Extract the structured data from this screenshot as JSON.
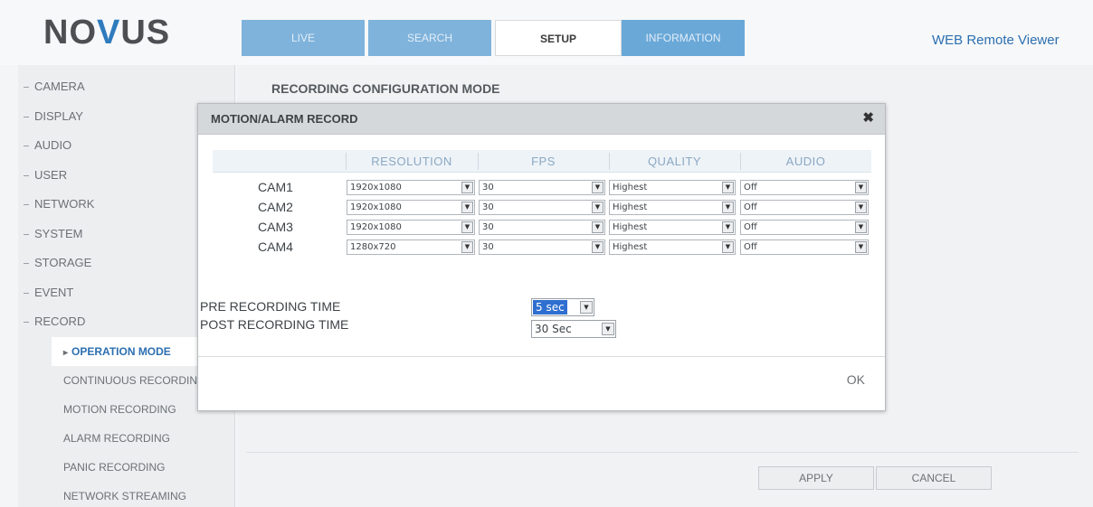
{
  "header": {
    "logo_prefix": "NO",
    "logo_v": "V",
    "logo_suffix": "US",
    "tabs": [
      {
        "label": "LIVE"
      },
      {
        "label": "SEARCH"
      },
      {
        "label": "SETUP"
      },
      {
        "label": "INFORMATION"
      }
    ],
    "active_tab": "SETUP",
    "app_title": "WEB Remote Viewer"
  },
  "sidebar": {
    "items": [
      {
        "label": "CAMERA"
      },
      {
        "label": "DISPLAY"
      },
      {
        "label": "AUDIO"
      },
      {
        "label": "USER"
      },
      {
        "label": "NETWORK"
      },
      {
        "label": "SYSTEM"
      },
      {
        "label": "STORAGE"
      },
      {
        "label": "EVENT"
      },
      {
        "label": "RECORD"
      }
    ],
    "sub_items": [
      {
        "label": "OPERATION MODE"
      },
      {
        "label": "CONTINUOUS RECORDING"
      },
      {
        "label": "MOTION RECORDING"
      },
      {
        "label": "ALARM RECORDING"
      },
      {
        "label": "PANIC RECORDING"
      },
      {
        "label": "NETWORK STREAMING"
      }
    ]
  },
  "main": {
    "section_title": "RECORDING CONFIGURATION MODE",
    "apply_label": "APPLY",
    "cancel_label": "CANCEL"
  },
  "modal": {
    "title": "MOTION/ALARM RECORD",
    "close_glyph": "✖",
    "columns": [
      "RESOLUTION",
      "FPS",
      "QUALITY",
      "AUDIO"
    ],
    "cameras": [
      {
        "name": "CAM1",
        "resolution": "1920x1080",
        "fps": "30",
        "quality": "Highest",
        "audio": "Off"
      },
      {
        "name": "CAM2",
        "resolution": "1920x1080",
        "fps": "30",
        "quality": "Highest",
        "audio": "Off"
      },
      {
        "name": "CAM3",
        "resolution": "1920x1080",
        "fps": "30",
        "quality": "Highest",
        "audio": "Off"
      },
      {
        "name": "CAM4",
        "resolution": "1280x720",
        "fps": "30",
        "quality": "Highest",
        "audio": "Off"
      }
    ],
    "pre_recording_label": "PRE RECORDING TIME",
    "pre_recording_value": "5 sec",
    "post_recording_label": "POST RECORDING TIME",
    "post_recording_value": "30 Sec",
    "ok_label": "OK"
  }
}
